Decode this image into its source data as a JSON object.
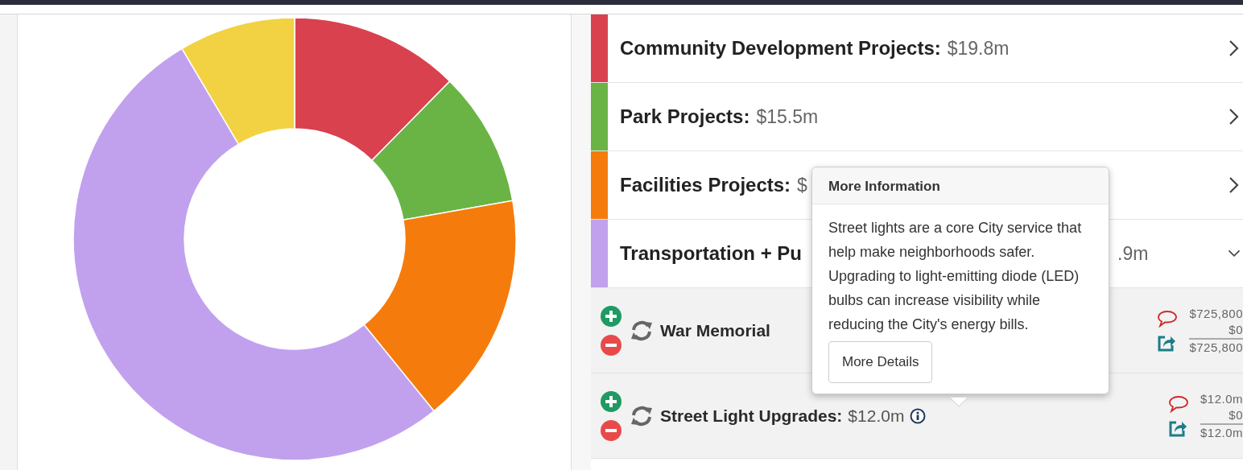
{
  "donut": {
    "slices": [
      {
        "color": "#d9414f"
      },
      {
        "color": "#6ab446"
      },
      {
        "color": "#f57c0c"
      },
      {
        "color": "#c1a1ee"
      },
      {
        "color": "#f2d242"
      }
    ]
  },
  "categories": [
    {
      "name": "Community Development Projects:",
      "amount": "$19.8m",
      "color": "#d9414f",
      "expanded": false
    },
    {
      "name": "Park Projects:",
      "amount": "$15.5m",
      "color": "#6ab446",
      "expanded": false
    },
    {
      "name": "Facilities Projects:",
      "amount": "$",
      "color": "#f57c0c",
      "expanded": false
    },
    {
      "name": "Transportation + Pu",
      "amount": ".9m",
      "color": "#c1a1ee",
      "expanded": true
    }
  ],
  "projects": [
    {
      "name": "War Memorial",
      "values": [
        "$725,800",
        "$0",
        "$725,800"
      ]
    },
    {
      "name": "Street Light Upgrades:",
      "amount": "$12.0m",
      "info": true,
      "values": [
        "$12.0m",
        "$0",
        "$12.0m"
      ]
    }
  ],
  "popover": {
    "title": "More Information",
    "text": "Street lights are a core City service that help make neighborhoods safer. Upgrading to light-emitting diode (LED) bulbs can increase visibility while reducing the City's energy bills.",
    "button": "More Details"
  }
}
